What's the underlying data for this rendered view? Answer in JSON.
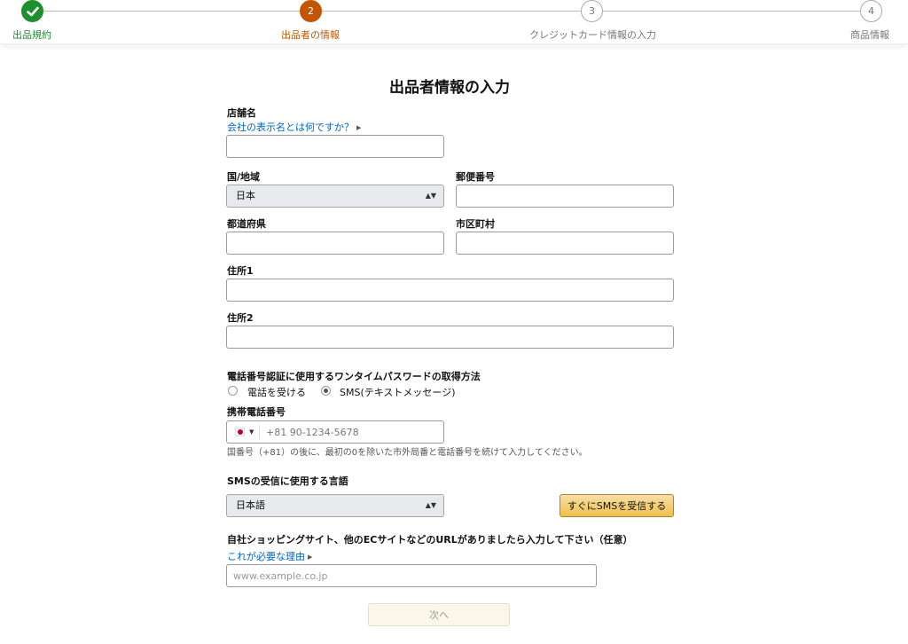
{
  "steps": [
    {
      "label": "出品規約",
      "number": "",
      "state": "done"
    },
    {
      "label": "出品者の情報",
      "number": "2",
      "state": "active"
    },
    {
      "label": "クレジットカード情報の入力",
      "number": "3",
      "state": "todo"
    },
    {
      "label": "商品情報",
      "number": "4",
      "state": "todo"
    }
  ],
  "form": {
    "title": "出品者情報の入力",
    "store_name": {
      "label": "店舗名",
      "help_link": "会社の表示名とは何ですか？",
      "value": ""
    },
    "country": {
      "label": "国/地域",
      "selected": "日本"
    },
    "postal_code": {
      "label": "郵便番号",
      "value": ""
    },
    "prefecture": {
      "label": "都道府県",
      "value": ""
    },
    "city": {
      "label": "市区町村",
      "value": ""
    },
    "address1": {
      "label": "住所1",
      "value": ""
    },
    "address2": {
      "label": "住所2",
      "value": ""
    },
    "otp": {
      "label": "電話番号認証に使用するワンタイムパスワードの取得方法",
      "options": [
        {
          "label": "電話を受ける",
          "selected": false
        },
        {
          "label": "SMS(テキストメッセージ)",
          "selected": true
        }
      ]
    },
    "mobile": {
      "label": "携帯電話番号",
      "placeholder": "+81 90-1234-5678",
      "value": "",
      "hint": "国番号（+81）の後に、最初の0を除いた市外局番と電話番号を続けて入力してください。"
    },
    "sms_language": {
      "label": "SMSの受信に使用する言語",
      "selected": "日本語",
      "send_button": "すぐにSMSを受信する"
    },
    "website": {
      "label": "自社ショッピングサイト、他のECサイトなどのURLがありましたら入力して下さい（任意）",
      "help_link": "これが必要な理由",
      "placeholder": "www.example.co.jp",
      "value": ""
    },
    "next_button": "次へ"
  },
  "colors": {
    "done": "#1e8f2e",
    "active": "#c45500",
    "link": "#0066c0",
    "button": "#f0c14b"
  }
}
